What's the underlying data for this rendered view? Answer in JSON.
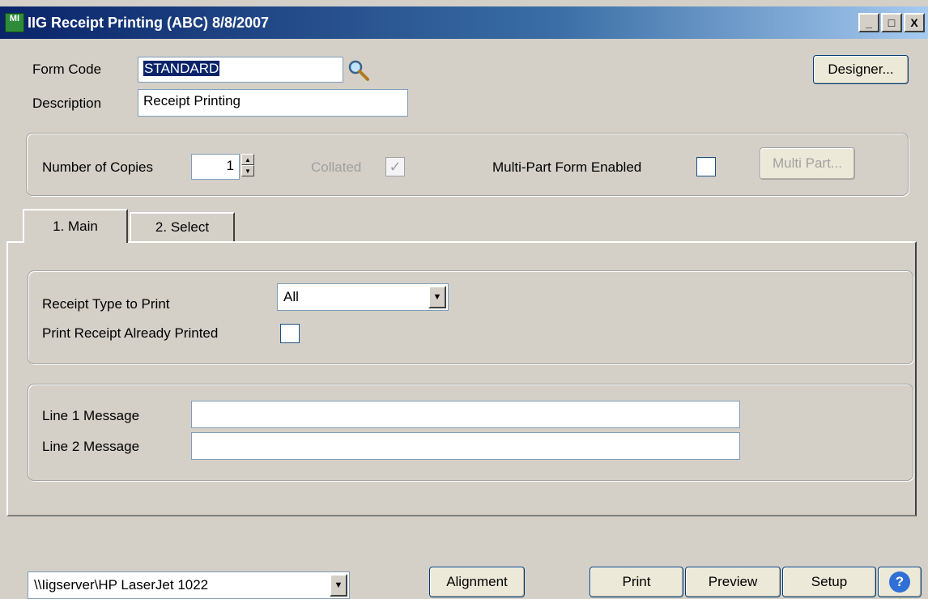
{
  "window": {
    "title": "IIG Receipt Printing (ABC) 8/8/2007",
    "icon_text": "MI",
    "controls": {
      "minimize": "_",
      "maximize": "□",
      "close": "X"
    }
  },
  "form": {
    "form_code_label": "Form Code",
    "form_code_value": "STANDARD",
    "description_label": "Description",
    "description_value": "Receipt Printing",
    "designer_button": "Designer..."
  },
  "copies": {
    "number_label": "Number of Copies",
    "number_value": "1",
    "collated_label": "Collated",
    "collated_checked": true,
    "multipart_label": "Multi-Part Form Enabled",
    "multipart_checked": false,
    "multipart_button": "Multi Part..."
  },
  "tabs": [
    {
      "label": "1. Main",
      "active": true
    },
    {
      "label": "2. Select",
      "active": false
    }
  ],
  "main": {
    "receipt_type_label": "Receipt Type to Print",
    "receipt_type_value": "All",
    "already_printed_label": "Print Receipt Already Printed",
    "already_printed_checked": false,
    "line1_label": "Line 1 Message",
    "line1_value": "",
    "line2_label": "Line 2 Message",
    "line2_value": ""
  },
  "footer": {
    "printer_value": "\\\\Iigserver\\HP LaserJet 1022",
    "alignment_button": "Alignment",
    "print_button": "Print",
    "preview_button": "Preview",
    "setup_button": "Setup",
    "help_button": "?"
  },
  "colors": {
    "titlebar_start": "#0a246a",
    "titlebar_end": "#a6caf0",
    "face": "#d4d0c8",
    "selection": "#0a246a",
    "check": "#21a121"
  },
  "icons": {
    "app": "app-icon",
    "lookup": "magnifier-icon",
    "dropdown": "chevron-down-icon",
    "help": "help-icon"
  }
}
